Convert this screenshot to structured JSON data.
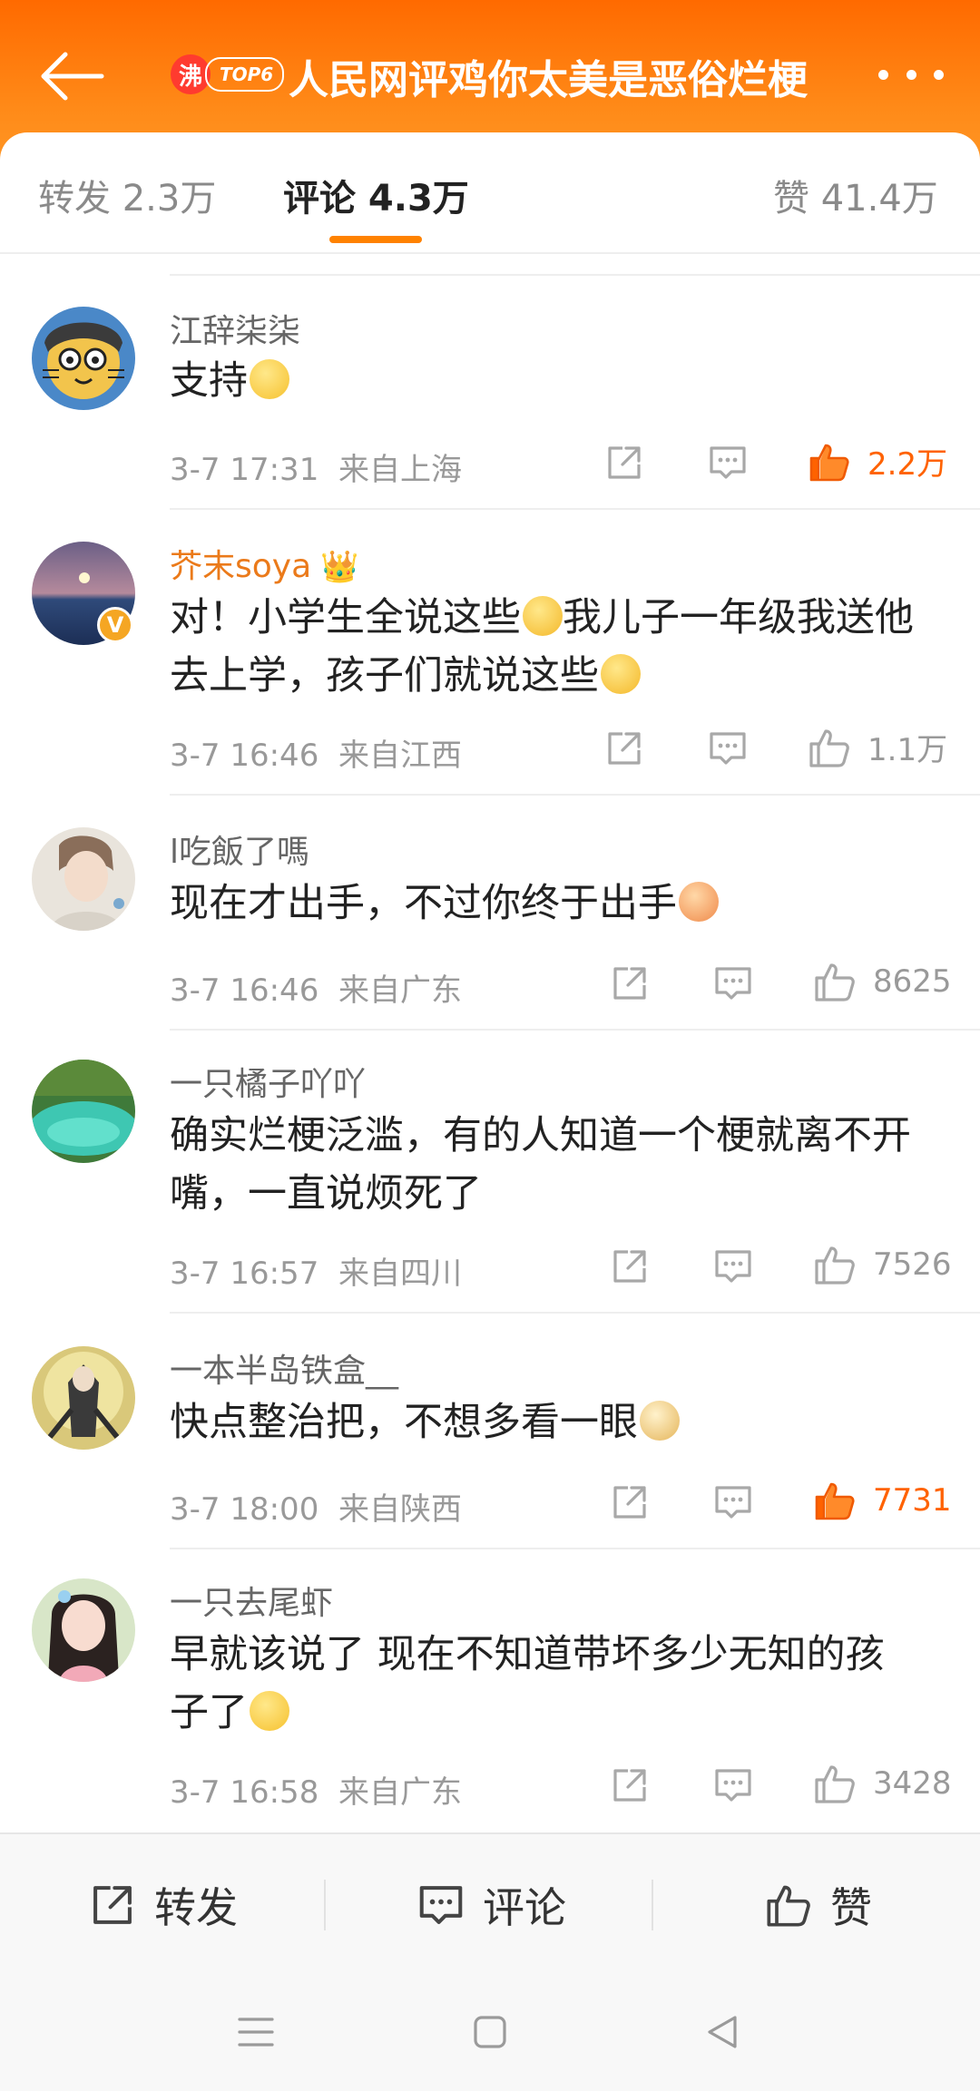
{
  "header": {
    "back_icon": "arrow-left-icon",
    "hot_badge_char": "沸",
    "hot_badge_rank": "TOP6",
    "title": "人民网评鸡你太美是恶俗烂梗",
    "more_icon": "more-dots-icon",
    "accent_color": "#ff7a10"
  },
  "tabs": [
    {
      "label": "转发 2.3万",
      "active": false
    },
    {
      "label": "评论 4.3万",
      "active": true
    },
    {
      "label": "赞 41.4万",
      "active": false
    }
  ],
  "comments": [
    {
      "user": "江辞柒柒",
      "text": "支持",
      "emoji": "smile-emoji",
      "time": "3-7 17:31",
      "location": "来自上海",
      "likes": "2.2万",
      "liked": true
    },
    {
      "user": "芥末soya",
      "text_line1": "对！小学生全说这些",
      "text_line1b": "我儿子一年级我送他",
      "text_line2": "去上学，孩子们就说这些",
      "emoji": "laugh-cry-emoji",
      "badge": "crown-icon",
      "verified": "V",
      "time": "3-7 16:46",
      "location": "来自江西",
      "likes": "1.1万",
      "liked": false
    },
    {
      "user": "l吃飯了嗎",
      "text": "现在才出手，不过你终于出手",
      "emoji": "kiss-emoji",
      "time": "3-7 16:46",
      "location": "来自广东",
      "likes": "8625",
      "liked": false
    },
    {
      "user": "一只橘子吖吖",
      "text_line1": "确实烂梗泛滥，有的人知道一个梗就离不开",
      "text_line2": "嘴，一直说烦死了",
      "time": "3-7 16:57",
      "location": "来自四川",
      "likes": "7526",
      "liked": false
    },
    {
      "user": "一本半岛铁盒__",
      "text": "快点整治把，不想多看一眼",
      "emoji": "doge-emoji",
      "time": "3-7 18:00",
      "location": "来自陕西",
      "likes": "7731",
      "liked": true
    },
    {
      "user": "一只去尾虾",
      "text_line1": "早就该说了 现在不知道带坏多少无知的孩",
      "text_line2": "子了",
      "emoji": "smile-emoji",
      "time": "3-7 16:58",
      "location": "来自广东",
      "likes": "3428",
      "liked": false
    }
  ],
  "bottom_bar": {
    "repost_label": "转发",
    "comment_label": "评论",
    "like_label": "赞"
  },
  "system_nav": [
    "menu-icon",
    "home-square-icon",
    "back-triangle-icon"
  ]
}
